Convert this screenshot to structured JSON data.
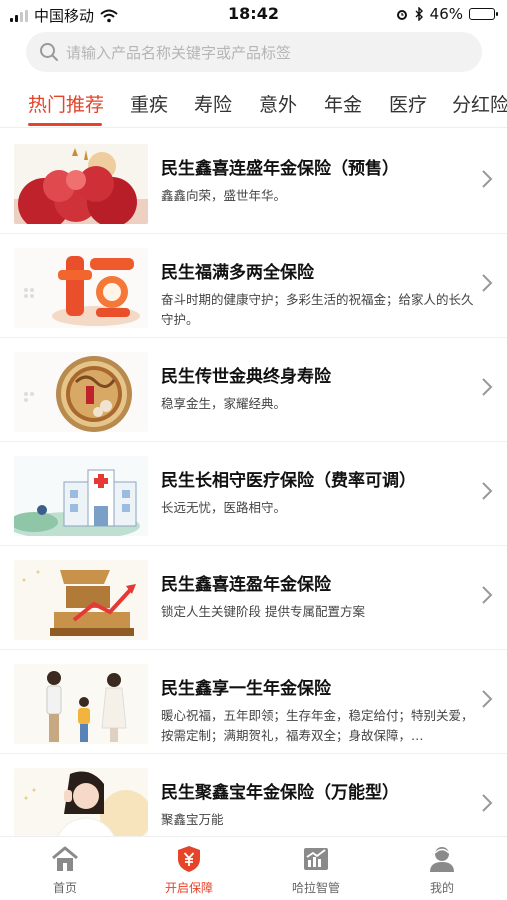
{
  "status_bar": {
    "carrier": "中国移动",
    "time": "18:42",
    "battery": "46%",
    "battery_level": 0.46
  },
  "search": {
    "placeholder": "请输入产品名称关键字或产品标签"
  },
  "category_tabs": [
    {
      "label": "热门推荐",
      "active": true
    },
    {
      "label": "重疾"
    },
    {
      "label": "寿险"
    },
    {
      "label": "意外"
    },
    {
      "label": "年金"
    },
    {
      "label": "医疗"
    },
    {
      "label": "分红险"
    }
  ],
  "products": [
    {
      "title": "民生鑫喜连盛年金保险（预售）",
      "desc": "鑫鑫向荣，盛世年华。",
      "thumb_icon": "peony-flower-icon"
    },
    {
      "title": "民生福满多两全保险",
      "desc": "奋斗时期的健康守护；多彩生活的祝福金；给家人的长久守护。",
      "thumb_icon": "fu-character-icon"
    },
    {
      "title": "民生传世金典终身寿险",
      "desc": "稳享金生，家耀经典。",
      "thumb_icon": "golden-medal-icon"
    },
    {
      "title": "民生长相守医疗保险（费率可调）",
      "desc": "长远无忧，医路相守。",
      "thumb_icon": "hospital-icon"
    },
    {
      "title": "民生鑫喜连盈年金保险",
      "desc": "锁定人生关键阶段  提供专属配置方案",
      "thumb_icon": "ying-character-icon"
    },
    {
      "title": "民生鑫享一生年金保险",
      "desc": "暖心祝福，五年即领；生存年金，稳定给付；特别关爱，按需定制；满期贺礼，福寿双全；身故保障，…",
      "thumb_icon": "family-icon"
    },
    {
      "title": "民生聚鑫宝年金保险（万能型）",
      "desc": "聚鑫宝万能",
      "thumb_icon": "woman-portrait-icon"
    }
  ],
  "bottom_nav": [
    {
      "label": "首页",
      "icon": "home-icon"
    },
    {
      "label": "开启保障",
      "icon": "shield-yuan-icon",
      "active": true
    },
    {
      "label": "哈拉智管",
      "icon": "chart-icon"
    },
    {
      "label": "我的",
      "icon": "user-icon"
    }
  ],
  "colors": {
    "accent": "#e3442a",
    "text": "#222222",
    "muted": "#b5b5b5"
  }
}
